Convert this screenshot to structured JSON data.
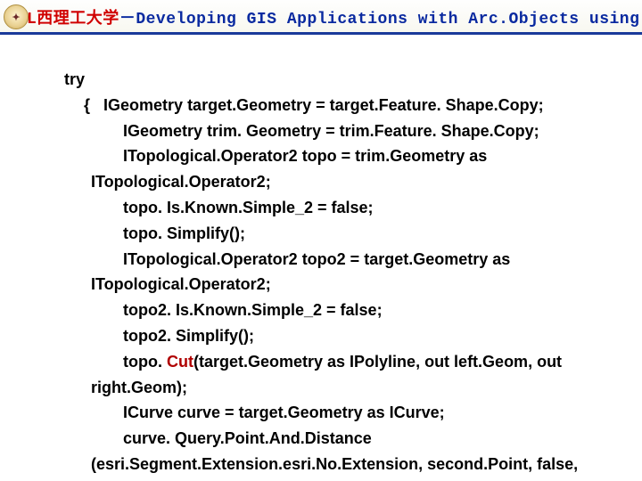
{
  "header": {
    "red_part": "L西理工大学",
    "separator": "－",
    "blue_part": "Developing GIS Applications with Arc.Objects using C#. NE"
  },
  "code": {
    "try_kw": "try",
    "open_brace": "{",
    "l1": "IGeometry target.Geometry = target.Feature. Shape.Copy;",
    "l2": "IGeometry trim. Geometry = trim.Feature. Shape.Copy;",
    "l3a": "ITopological.Operator2 topo = trim.Geometry as",
    "l3b": "ITopological.Operator2;",
    "l4": "topo. Is.Known.Simple_2 = false;",
    "l5": "topo. Simplify();",
    "l6a": "ITopological.Operator2 topo2 = target.Geometry as",
    "l6b": "ITopological.Operator2;",
    "l7": "topo2. Is.Known.Simple_2 = false;",
    "l8": "topo2. Simplify();",
    "l9a_pre": "topo. ",
    "l9a_cmd": "Cut",
    "l9a_post": "(target.Geometry as IPolyline, out left.Geom, out",
    "l9b": "right.Geom);",
    "l10": "ICurve curve = target.Geometry as ICurve;",
    "l11a": "curve. Query.Point.And.Distance",
    "l11b": "(esri.Segment.Extension.esri.No.Extension, second.Point, false,"
  }
}
